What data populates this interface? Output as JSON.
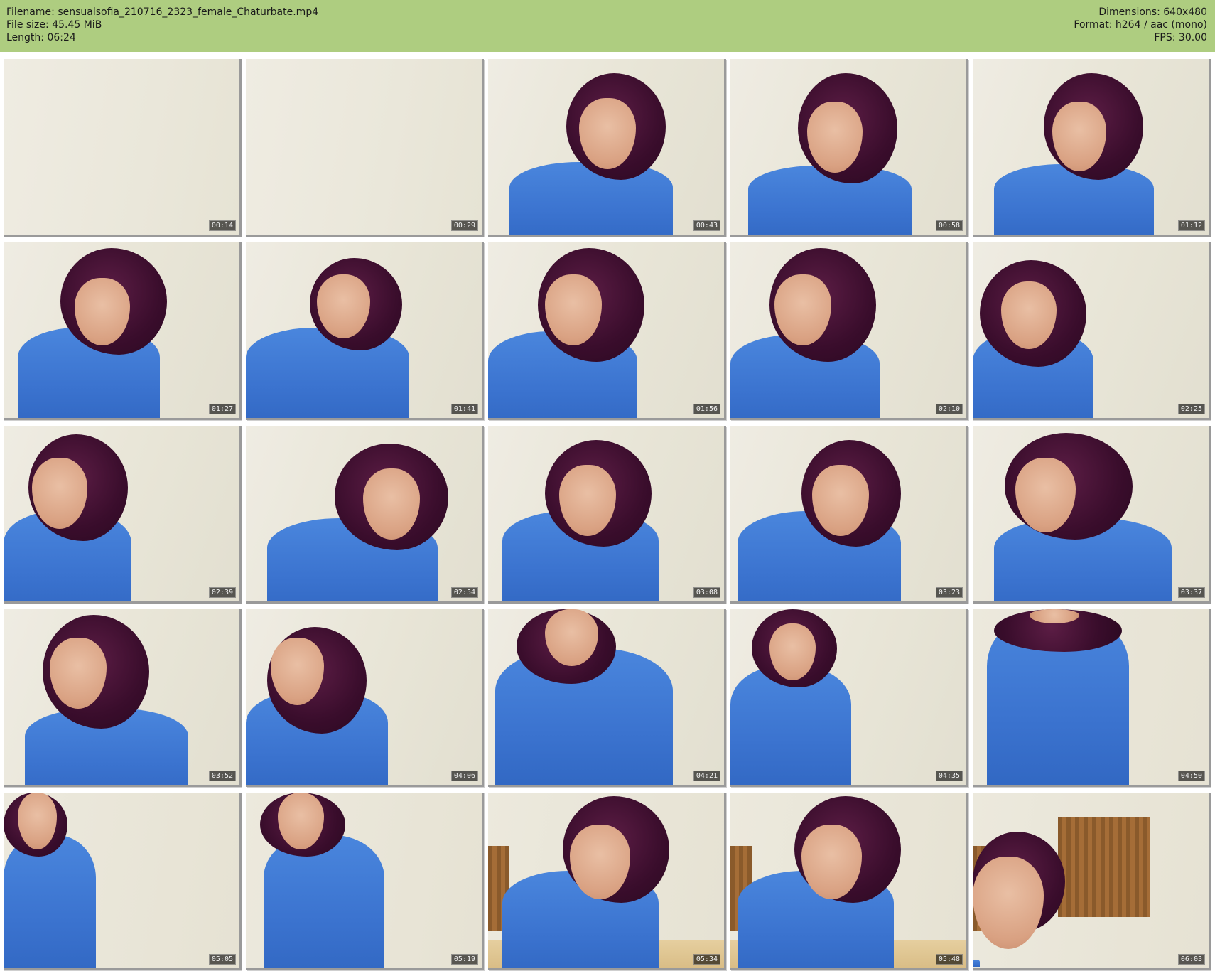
{
  "header": {
    "filename_label": "Filename:",
    "filename": "sensualsofia_210716_2323_female_Chaturbate.mp4",
    "filesize_label": "File size:",
    "filesize": "45.45 MiB",
    "length_label": "Length:",
    "length": "06:24",
    "dimensions_label": "Dimensions:",
    "dimensions": "640x480",
    "format_label": "Format:",
    "format": "h264 / aac (mono)",
    "fps_label": "FPS:",
    "fps": "30.00"
  },
  "colors": {
    "header_bg": "#aecd80",
    "shirt": "#3b73cf",
    "hair": "#3a0d2c",
    "wall": "#ebe8db"
  },
  "thumbnails": [
    {
      "time": "00:14"
    },
    {
      "time": "00:29"
    },
    {
      "time": "00:43"
    },
    {
      "time": "00:58"
    },
    {
      "time": "01:12"
    },
    {
      "time": "01:27"
    },
    {
      "time": "01:41"
    },
    {
      "time": "01:56"
    },
    {
      "time": "02:10"
    },
    {
      "time": "02:25"
    },
    {
      "time": "02:39"
    },
    {
      "time": "02:54"
    },
    {
      "time": "03:08"
    },
    {
      "time": "03:23"
    },
    {
      "time": "03:37"
    },
    {
      "time": "03:52"
    },
    {
      "time": "04:06"
    },
    {
      "time": "04:21"
    },
    {
      "time": "04:35"
    },
    {
      "time": "04:50"
    },
    {
      "time": "05:05"
    },
    {
      "time": "05:19"
    },
    {
      "time": "05:34"
    },
    {
      "time": "05:48"
    },
    {
      "time": "06:03"
    }
  ]
}
